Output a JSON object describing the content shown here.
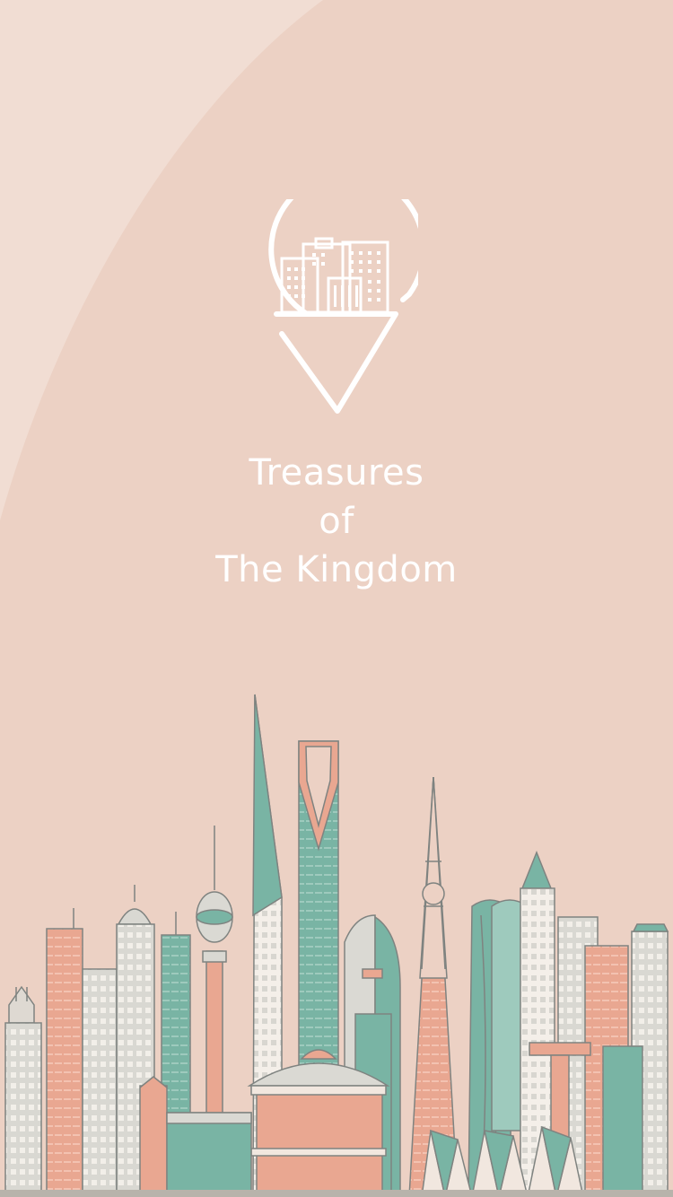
{
  "splash": {
    "title_line1": "Treasures",
    "title_line2": "of",
    "title_line3": "The Kingdom",
    "logo_icon": "city-location-pin-icon",
    "illustration": "city-skyline-illustration"
  },
  "colors": {
    "background": "#ecd1c4",
    "background_arc": "#f1ddd3",
    "text": "#ffffff",
    "teal": "#79b4a4",
    "salmon": "#e9a791",
    "light_gray": "#d6d5cf",
    "outline": "#8a8a83"
  }
}
